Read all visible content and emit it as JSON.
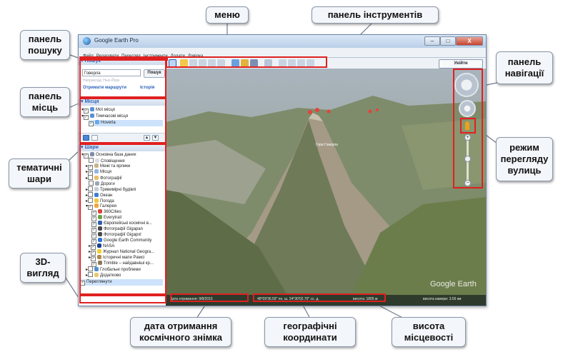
{
  "window": {
    "title": "Google Earth Pro",
    "controls": {
      "minimize": "–",
      "maximize": "□",
      "close": "X"
    }
  },
  "menu": [
    "Файл",
    "Редагувати",
    "Перегляд",
    "Інструменти",
    "Додати",
    "Довідка"
  ],
  "toolbar": {
    "login_label": "Увійти"
  },
  "search": {
    "header": "Пошук",
    "input_value": "Говерла",
    "button": "Пошук",
    "hint": "Наприклад: Нью-Йорк",
    "route_link": "Отримати маршрути",
    "history_link": "Історія"
  },
  "places": {
    "header": "Місця",
    "items": [
      "Мої місця",
      "Тимчасові місця",
      "Hoverla"
    ]
  },
  "layers": {
    "header": "Шари",
    "items": [
      "Основна база даних",
      "Сповіщення",
      "Межі та ярлики",
      "Місця",
      "Фотографії",
      "Дороги",
      "Тривимірні будівлі",
      "Океан",
      "Погода",
      "Галерея",
      "360Cities",
      "Everytrail",
      "Європейські космічні в...",
      "Фотографії Gigapan",
      "Фотографії Gigapxl",
      "Google Earth Community",
      "NASA",
      "Журнал National Geogra...",
      "Історичні мапи Рамсі",
      "Trimble – найдавніші кр...",
      "Глобальні проблеми",
      "Додатково"
    ],
    "footer_item": "Переглянути"
  },
  "map": {
    "peak_label": "Гора Говерла",
    "logo": "Google Earth",
    "status": {
      "imagery_date": "Дата отримання: 9/8/2015",
      "coords": "48°09'36.59\" пн. ш.  24°30'02.70\" сх. д.",
      "elevation": "висота: 1805 м",
      "eye_alt": "висота камери: 3.55 км"
    }
  },
  "callouts": {
    "menu": "меню",
    "toolbar": "панель інструментів",
    "search_panel": "панель\nпошуку",
    "places_panel": "панель\nмісць",
    "layers_panel": "тематичні\nшари",
    "view3d": "3D-\nвигляд",
    "imagery_date": "дата отримання\nкосмічного знімка",
    "coords": "географічні\nкоординати",
    "elevation": "висота\nмісцевості",
    "nav_panel": "панель\nнавігації",
    "street_view": "режим\nперегляду\nвулиць"
  },
  "colors": {
    "highlight": "#e02020",
    "link_blue": "#2b62b8"
  }
}
